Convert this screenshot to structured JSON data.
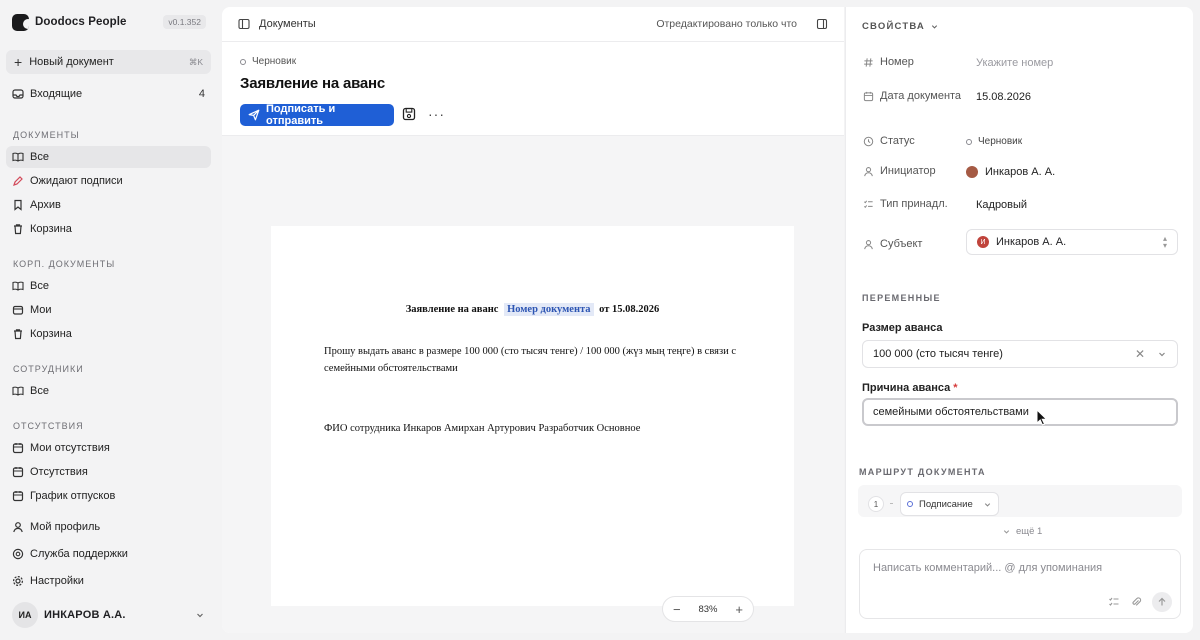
{
  "app": {
    "name": "Doodocs People",
    "version": "v0.1.352"
  },
  "sidebar": {
    "new_doc": {
      "label": "Новый документ",
      "shortcut": "⌘K"
    },
    "inbox": {
      "label": "Входящие",
      "count": "4"
    },
    "sections": {
      "documents": {
        "title": "ДОКУМЕНТЫ",
        "items": [
          "Все",
          "Ожидают подписи",
          "Архив",
          "Корзина"
        ]
      },
      "corp": {
        "title": "КОРП. ДОКУМЕНТЫ",
        "items": [
          "Все",
          "Мои",
          "Корзина"
        ]
      },
      "employees": {
        "title": "СОТРУДНИКИ",
        "items": [
          "Все"
        ]
      },
      "absences": {
        "title": "ОТСУТСТВИЯ",
        "items": [
          "Мои отсутствия",
          "Отсутствия",
          "График отпусков"
        ]
      }
    },
    "bottom": {
      "profile": "Мой профиль",
      "support": "Служба поддержки",
      "settings": "Настройки"
    },
    "user": {
      "initials": "ИА",
      "name": "ИНКАРОВ А.А."
    }
  },
  "main": {
    "breadcrumb": "Документы",
    "edited": "Отредактировано только что",
    "status": "Черновик",
    "title": "Заявление на аванс",
    "sign_button": "Подписать и отправить",
    "paper": {
      "title_prefix": "Заявление на аванс",
      "title_chip": "Номер документа",
      "title_suffix": "от 15.08.2026",
      "body": "Прошу выдать аванс в размере 100 000 (сто тысяч тенге) / 100 000 (жүз мың теңге) в связи с семейными обстоятельствами",
      "signature": "ФИО сотрудника Инкаров Амирхан Артурович Разработчик Основное"
    },
    "zoom": "83%"
  },
  "properties": {
    "title": "СВОЙСТВА",
    "number": {
      "label": "Номер",
      "placeholder": "Укажите номер"
    },
    "date": {
      "label": "Дата документа",
      "value": "15.08.2026"
    },
    "status": {
      "label": "Статус",
      "value": "Черновик"
    },
    "initiator": {
      "label": "Инициатор",
      "value": "Инкаров А. А."
    },
    "type": {
      "label": "Тип принадл.",
      "value": "Кадровый"
    },
    "subject": {
      "label": "Субъект",
      "value": "Инкаров А. А.",
      "avatar_letter": "И"
    }
  },
  "variables": {
    "title": "ПЕРЕМЕННЫЕ",
    "advance_size": {
      "label": "Размер аванса",
      "value": "100 000 (сто тысяч тенге)"
    },
    "advance_reason": {
      "label": "Причина аванса",
      "required_mark": "*",
      "value": "семейными обстоятельствами"
    }
  },
  "route": {
    "title": "МАРШРУТ ДОКУМЕНТА",
    "step_number": "1",
    "step_label": "Подписание",
    "more": "ещё 1"
  },
  "comment": {
    "placeholder": "Написать комментарий... @ для упоминания"
  },
  "colors": {
    "accent": "#1f5fd6",
    "required": "#d63a3a",
    "chip_bg": "#e3e9f7",
    "chip_text": "#2d55b3"
  }
}
